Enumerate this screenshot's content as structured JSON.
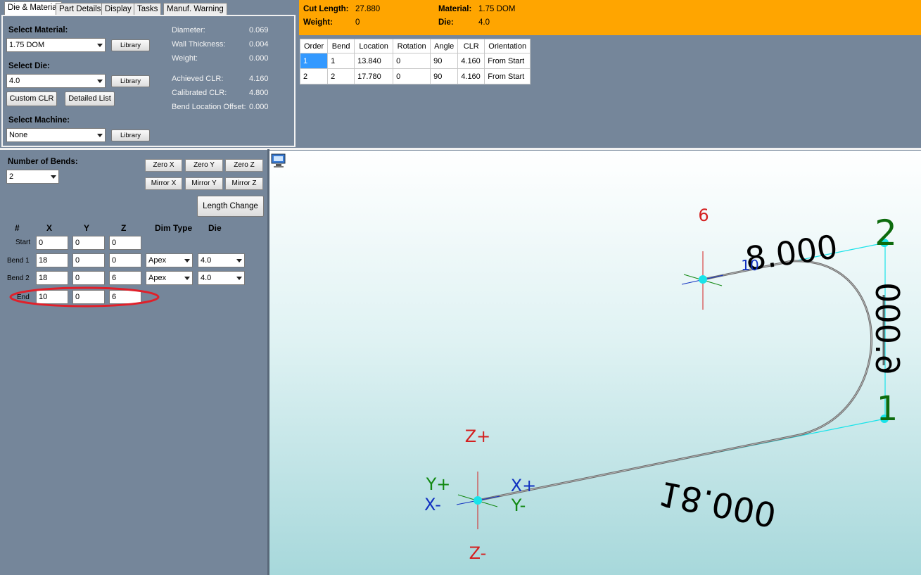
{
  "tabs": [
    {
      "label": "Die & Material",
      "active": true
    },
    {
      "label": "Part Details",
      "active": false
    },
    {
      "label": "Display",
      "active": false
    },
    {
      "label": "Tasks",
      "active": false
    },
    {
      "label": "Manuf. Warning",
      "active": false
    }
  ],
  "die_material": {
    "select_material_label": "Select Material:",
    "material_value": "1.75 DOM",
    "select_die_label": "Select Die:",
    "die_value": "4.0",
    "select_machine_label": "Select Machine:",
    "machine_value": "None",
    "library_label": "Library",
    "custom_clr_label": "Custom CLR",
    "detailed_list_label": "Detailed List",
    "properties": [
      {
        "label": "Diameter:",
        "value": "0.069"
      },
      {
        "label": "Wall Thickness:",
        "value": "0.004"
      },
      {
        "label": "Weight:",
        "value": "0.000"
      },
      {
        "label": "Achieved CLR:",
        "value": "4.160"
      },
      {
        "label": "Calibrated CLR:",
        "value": "4.800"
      },
      {
        "label": "Bend Location Offset:",
        "value": "0.000"
      }
    ]
  },
  "info_bar": {
    "cut_length_label": "Cut Length:",
    "cut_length_value": "27.880",
    "weight_label": "Weight:",
    "weight_value": "0",
    "material_label": "Material:",
    "material_value": "1.75 DOM",
    "die_label": "Die:",
    "die_value": "4.0",
    "background_color": "#ffa500"
  },
  "bend_table": {
    "columns": [
      "Order",
      "Bend",
      "Location",
      "Rotation",
      "Angle",
      "CLR",
      "Orientation"
    ],
    "rows": [
      [
        "1",
        "1",
        "13.840",
        "0",
        "90",
        "4.160",
        "From Start"
      ],
      [
        "2",
        "2",
        "17.780",
        "0",
        "90",
        "4.160",
        "From Start"
      ]
    ]
  },
  "bends_panel": {
    "number_of_bends_label": "Number of Bends:",
    "number_of_bends_value": "2",
    "zero_x": "Zero X",
    "zero_y": "Zero Y",
    "zero_z": "Zero Z",
    "mirror_x": "Mirror X",
    "mirror_y": "Mirror Y",
    "mirror_z": "Mirror Z",
    "length_change": "Length Change",
    "headers": {
      "num": "#",
      "x": "X",
      "y": "Y",
      "z": "Z",
      "dim_type": "Dim Type",
      "die": "Die"
    },
    "rows": [
      {
        "label": "Start",
        "x": "0",
        "y": "0",
        "z": "0",
        "dim_type": "",
        "die": ""
      },
      {
        "label": "Bend 1",
        "x": "18",
        "y": "0",
        "z": "0",
        "dim_type": "Apex",
        "die": "4.0"
      },
      {
        "label": "Bend 2",
        "x": "18",
        "y": "0",
        "z": "6",
        "dim_type": "Apex",
        "die": "4.0"
      },
      {
        "label": "End",
        "x": "10",
        "y": "0",
        "z": "6",
        "dim_type": "",
        "die": ""
      }
    ],
    "highlight_color": "#e0202a"
  },
  "viewport": {
    "dim_18": "18.000",
    "dim_6": "6.000",
    "dim_8": "8.000",
    "bend_1_label": "1",
    "bend_2_label": "2",
    "end_marker_label": "6",
    "end_small_label": "10",
    "axis_z_plus": "Z+",
    "axis_z_minus": "Z-",
    "axis_x_plus": "X+",
    "axis_x_minus": "X-",
    "axis_y_plus": "Y+",
    "axis_y_minus": "Y-",
    "colors": {
      "axis_red": "#d42020",
      "axis_blue": "#1030c0",
      "axis_green": "#118811",
      "node": "#19e3e9",
      "bend_label": "#0d6b0d"
    }
  }
}
